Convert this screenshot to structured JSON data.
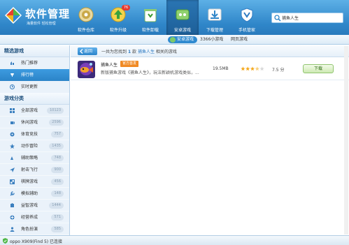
{
  "app": {
    "title": "软件管理",
    "slogan": "海量软件 轻松管理"
  },
  "nav": [
    {
      "label": "软件仓库",
      "icon": "software-store-icon"
    },
    {
      "label": "软件升级",
      "icon": "software-upgrade-icon",
      "badge": "76"
    },
    {
      "label": "软件卸载",
      "icon": "uninstall-recycle-icon"
    },
    {
      "label": "安卓游戏",
      "icon": "android-games-icon",
      "active": true
    },
    {
      "label": "下载管理",
      "icon": "download-manager-icon"
    },
    {
      "label": "手机管家",
      "icon": "phone-manager-icon"
    }
  ],
  "search": {
    "value": "捕鱼人生"
  },
  "subtabs": {
    "active": "安卓游戏",
    "games": "3366小游戏",
    "web": "网页游戏"
  },
  "sidebar": {
    "section1": "精选游戏",
    "featured": [
      {
        "label": "热门推荐",
        "icon": "hot-recommend-icon"
      },
      {
        "label": "排行榜",
        "icon": "ranking-icon",
        "active": true
      },
      {
        "label": "实时更新",
        "icon": "clock-update-icon"
      }
    ],
    "section2": "游戏分类",
    "categories": [
      {
        "label": "全部游戏",
        "count": "10123",
        "icon": "grid-icon"
      },
      {
        "label": "休闲游戏",
        "count": "2596",
        "icon": "coffee-icon"
      },
      {
        "label": "体育竞技",
        "count": "757",
        "icon": "sports-icon"
      },
      {
        "label": "动作冒险",
        "count": "1435",
        "icon": "action-icon"
      },
      {
        "label": "辅助策略",
        "count": "748",
        "icon": "strategy-icon"
      },
      {
        "label": "射击飞行",
        "count": "900",
        "icon": "plane-icon"
      },
      {
        "label": "棋牌游戏",
        "count": "456",
        "icon": "chess-icon"
      },
      {
        "label": "模拟辅助",
        "count": "148",
        "icon": "wrench-icon"
      },
      {
        "label": "益智游戏",
        "count": "1444",
        "icon": "puzzle-icon"
      },
      {
        "label": "经营养成",
        "count": "571",
        "icon": "manage-icon"
      },
      {
        "label": "角色扮演",
        "count": "585",
        "icon": "role-icon"
      }
    ]
  },
  "main": {
    "back_label": "返回",
    "result_prefix": "一共为您找到",
    "result_count": "1",
    "result_mid": "款",
    "result_keyword": "捕鱼人生",
    "result_suffix": "相关的游戏",
    "games": [
      {
        "name": "捕鱼人生",
        "tag": "官方首发",
        "desc": "新版捕鱼游戏《捕鱼人生》，玩法新颖机游戏类似，...",
        "size": "19.5MB",
        "rating": "7.5 分",
        "stars": 3.75,
        "download_label": "下载"
      }
    ]
  },
  "status": {
    "text": "oppo X909(Find 5) 已连接"
  }
}
